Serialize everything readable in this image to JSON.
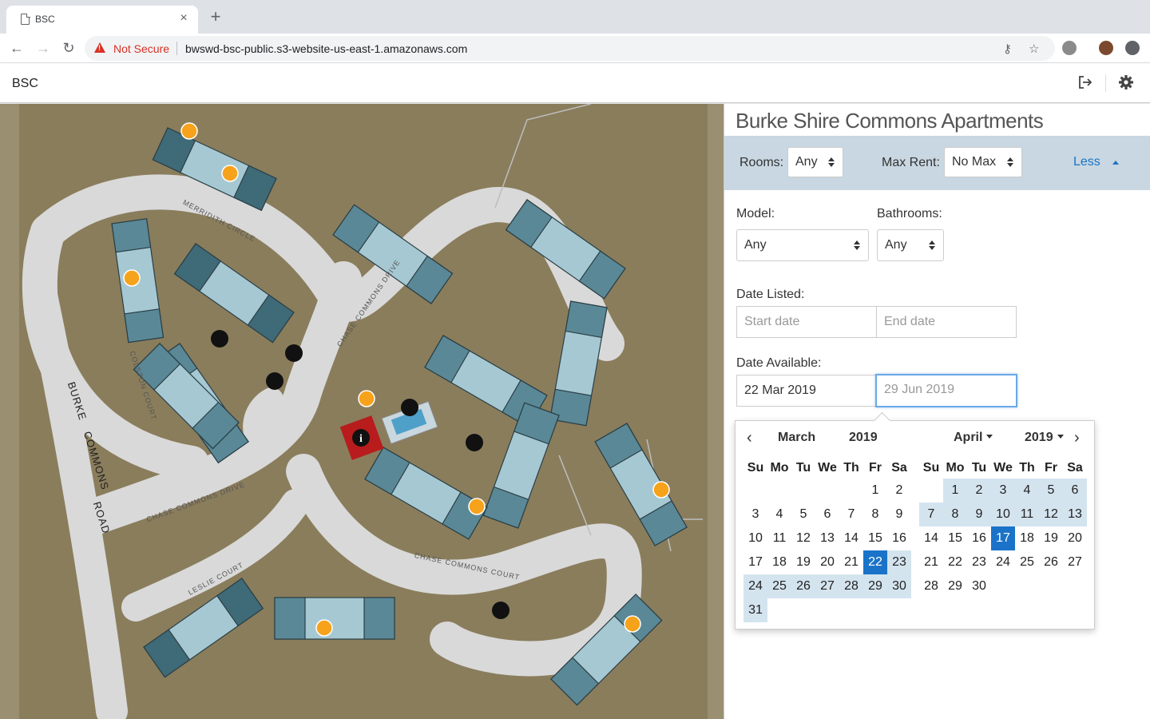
{
  "browser": {
    "tab_title": "BSC",
    "tab_close": "×",
    "new_tab": "+",
    "security_label": "Not Secure",
    "url": "bwswd-bsc-public.s3-website-us-east-1.amazonaws.com"
  },
  "app": {
    "title": "BSC"
  },
  "map": {
    "street_labels": [
      "MERRIDITH CIRCLE",
      "CHASE COMMONS DRIVE",
      "COLSTON COURT",
      "BURKE",
      "COMMONS",
      "ROAD",
      "CHASE COMMONS DRIVE",
      "LESLIE COURT",
      "CHASE COMMONS COURT"
    ]
  },
  "panel": {
    "title": "Burke Shire Commons Apartments",
    "rooms_label": "Rooms:",
    "rooms_value": "Any",
    "max_rent_label": "Max Rent:",
    "max_rent_value": "No Max",
    "less_label": "Less",
    "model_label": "Model:",
    "model_value": "Any",
    "bathrooms_label": "Bathrooms:",
    "bathrooms_value": "Any",
    "date_listed_label": "Date Listed:",
    "start_date_placeholder": "Start date",
    "end_date_placeholder": "End date",
    "date_available_label": "Date Available:",
    "available_start": "22 Mar 2019",
    "available_end_placeholder": "29 Jun 2019"
  },
  "datepicker": {
    "weekdays": [
      "Su",
      "Mo",
      "Tu",
      "We",
      "Th",
      "Fr",
      "Sa"
    ],
    "left": {
      "month": "March",
      "year": "2019",
      "first_weekday": 5,
      "days": 31,
      "range_start": 22,
      "range_end": 31,
      "selected": 22
    },
    "right": {
      "month": "April",
      "year": "2019",
      "first_weekday": 1,
      "days": 30,
      "range_start": 1,
      "range_end": 13,
      "selected": 17
    },
    "prev": "‹",
    "next": "›"
  }
}
